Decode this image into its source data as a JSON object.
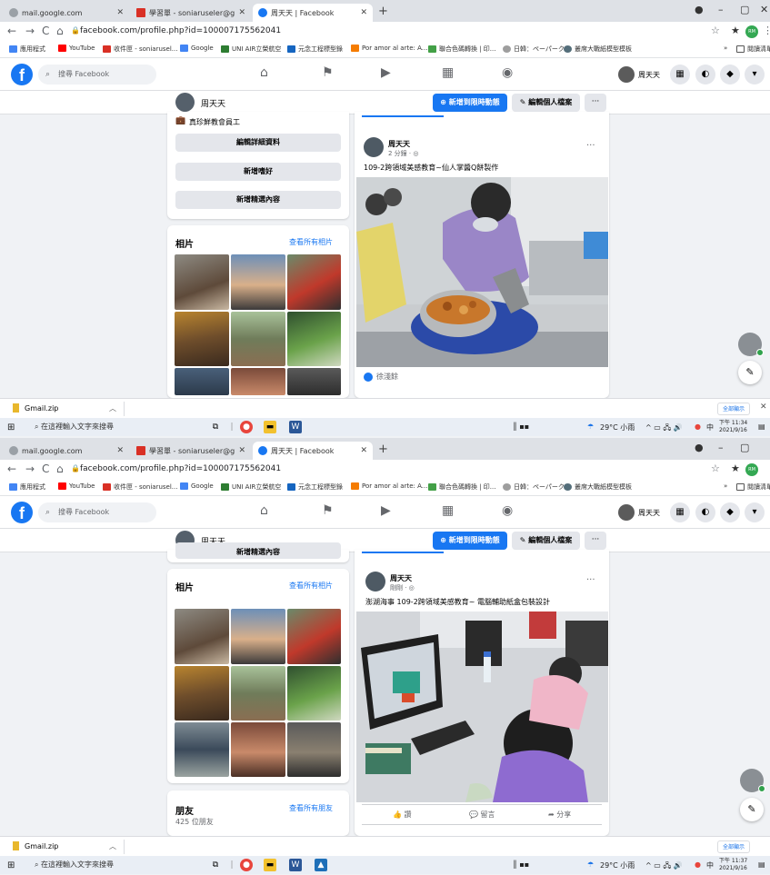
{
  "browser": {
    "tabs": [
      {
        "title": "mail.google.com",
        "color": "#9aa0a6"
      },
      {
        "title": "學習單 - soniaruseler@gmail.co",
        "color": "#d93025"
      },
      {
        "title": "周天天 | Facebook",
        "color": "#1877f2"
      }
    ],
    "tabs_bottom": [
      {
        "title": "mail.google.com",
        "color": "#9aa0a6"
      },
      {
        "title": "學習單 - soniaruseler@gmail.co",
        "color": "#d93025"
      },
      {
        "title": "周天天 | Facebook",
        "color": "#1877f2"
      }
    ],
    "new_tab": "+",
    "url": "facebook.com/profile.php?id=100007175562041",
    "bookmarks": [
      {
        "label": "應用程式",
        "color": "#4285f4"
      },
      {
        "label": "YouTube",
        "color": "#ff0000"
      },
      {
        "label": "收件匣 - soniarusel...",
        "color": "#d93025"
      },
      {
        "label": "Google",
        "color": "#4285f4"
      },
      {
        "label": "UNI AIR立榮航空",
        "color": "#2e7d32"
      },
      {
        "label": "元念工程標型錄",
        "color": "#1565c0"
      },
      {
        "label": "Por amor al arte: A...",
        "color": "#f57c00"
      },
      {
        "label": "聯合色碼轉換 | 印...",
        "color": "#43a047"
      },
      {
        "label": "日韓：ペーパーク...",
        "color": "#9e9e9e"
      },
      {
        "label": "叢席大戰紙模型模板",
        "color": "#546e7a"
      }
    ],
    "reading_list": "閱讀清單",
    "profile_badge": "RM"
  },
  "facebook": {
    "search_placeholder": "搜尋 Facebook",
    "logo_letter": "f",
    "me_name": "周天天",
    "profile_name": "周天天",
    "add_story": "新增到限時動態",
    "edit_profile": "編輯個人檔案",
    "more": "···"
  },
  "top": {
    "intro_line": "真珍鮮教會員工",
    "edit_details": "編輯詳細資料",
    "add_hobbies": "新增嗜好",
    "add_featured": "新增精選內容",
    "photos_title": "相片",
    "see_all_photos": "查看所有相片",
    "post": {
      "author": "周天天",
      "time": "2 分鐘 · ◎",
      "text": "109-2跨領域美感教育~仙人掌醬Q餅製作",
      "commenter": "徐淺餘"
    },
    "download_file": "Gmail.zip",
    "show_all": "全部顯示",
    "taskbar_search": "在這裡輸入文字來搜尋",
    "weather": "29°C 小雨",
    "ime": "中",
    "time": "下午 11:34",
    "date": "2021/9/16"
  },
  "bottom": {
    "add_featured": "新增精選內容",
    "photos_title": "相片",
    "see_all_photos": "查看所有相片",
    "friends_title": "朋友",
    "see_all_friends": "查看所有朋友",
    "friends_count": "425 位朋友",
    "post": {
      "author": "周天天",
      "time": "剛剛 · ◎",
      "text": "澎湖海事 109-2跨領域美感教育~ 電腦輔助紙盒包裝設計",
      "like": "讚",
      "comment": "留言",
      "share": "分享"
    },
    "download_file": "Gmail.zip",
    "show_all": "全部顯示",
    "taskbar_search": "在這裡輸入文字來搜尋",
    "weather": "29°C 小雨",
    "ime": "中",
    "time": "下午 11:37",
    "date": "2021/9/16"
  },
  "colors": {
    "fb_blue": "#1877f2",
    "page_bg": "#f0f2f5",
    "button_gray": "#e4e6eb"
  }
}
